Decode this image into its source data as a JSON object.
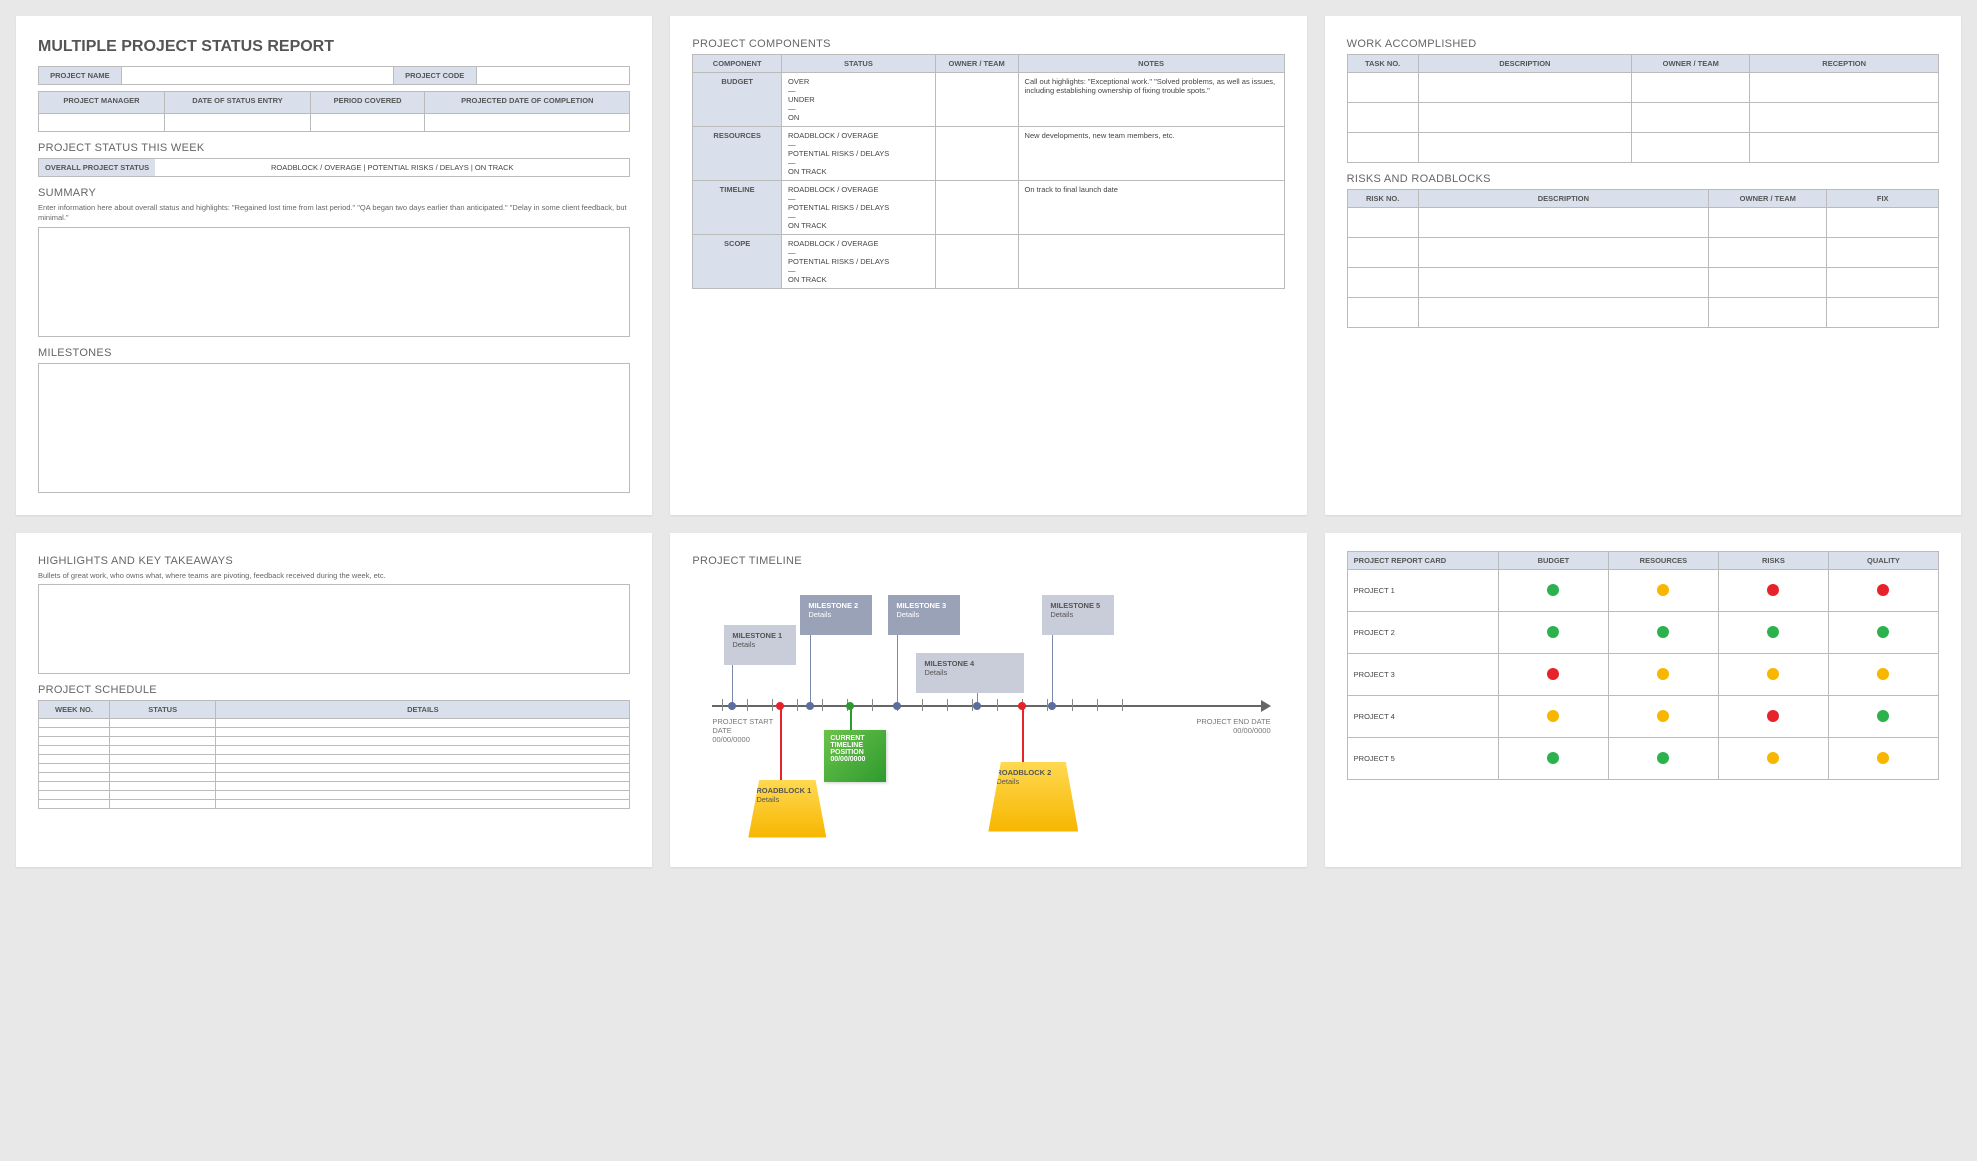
{
  "card1": {
    "title": "MULTIPLE PROJECT STATUS REPORT",
    "info1": {
      "name_lbl": "PROJECT NAME",
      "code_lbl": "PROJECT CODE"
    },
    "info2": {
      "pm": "PROJECT MANAGER",
      "date": "DATE OF STATUS ENTRY",
      "period": "PERIOD COVERED",
      "proj": "PROJECTED DATE OF COMPLETION"
    },
    "status_section": "PROJECT STATUS THIS WEEK",
    "status_lbl": "OVERALL PROJECT STATUS",
    "status_opts": "ROADBLOCK / OVERAGE    |    POTENTIAL RISKS / DELAYS    |    ON TRACK",
    "summary_lbl": "SUMMARY",
    "summary_hint": "Enter information here about overall status and highlights: \"Regained lost time from last period.\" \"QA began two days earlier than anticipated.\" \"Delay in some client feedback, but minimal.\"",
    "milestones_lbl": "MILESTONES"
  },
  "card2": {
    "title": "PROJECT COMPONENTS",
    "cols": [
      "COMPONENT",
      "STATUS",
      "OWNER / TEAM",
      "NOTES"
    ],
    "rows": [
      {
        "c": "BUDGET",
        "s": "OVER\n—\nUNDER\n—\nON",
        "n": "Call out highlights: \"Exceptional work.\" \"Solved problems, as well as issues, including establishing ownership of fixing trouble spots.\""
      },
      {
        "c": "RESOURCES",
        "s": "ROADBLOCK / OVERAGE\n—\nPOTENTIAL RISKS / DELAYS\n—\nON TRACK",
        "n": "New developments, new team members, etc."
      },
      {
        "c": "TIMELINE",
        "s": "ROADBLOCK / OVERAGE\n—\nPOTENTIAL RISKS / DELAYS\n—\nON TRACK",
        "n": "On track to final launch date"
      },
      {
        "c": "SCOPE",
        "s": "ROADBLOCK / OVERAGE\n—\nPOTENTIAL RISKS / DELAYS\n—\nON TRACK",
        "n": ""
      }
    ]
  },
  "card3": {
    "work_title": "WORK ACCOMPLISHED",
    "work_cols": [
      "TASK NO.",
      "DESCRIPTION",
      "OWNER / TEAM",
      "RECEPTION"
    ],
    "risk_title": "RISKS AND ROADBLOCKS",
    "risk_cols": [
      "RISK NO.",
      "DESCRIPTION",
      "OWNER / TEAM",
      "FIX"
    ]
  },
  "card4": {
    "hl_title": "HIGHLIGHTS AND KEY TAKEAWAYS",
    "hl_hint": "Bullets of great work, who owns what, where teams are pivoting, feedback received during the week, etc.",
    "sched_title": "PROJECT SCHEDULE",
    "sched_cols": [
      "WEEK NO.",
      "STATUS",
      "DETAILS"
    ]
  },
  "card5": {
    "title": "PROJECT TIMELINE",
    "start_lbl": "PROJECT START DATE",
    "start_date": "00/00/0000",
    "end_lbl": "PROJECT END DATE",
    "end_date": "00/00/0000",
    "milestones": [
      {
        "t": "MILESTONE 1",
        "d": "Details"
      },
      {
        "t": "MILESTONE 2",
        "d": "Details"
      },
      {
        "t": "MILESTONE 3",
        "d": "Details"
      },
      {
        "t": "MILESTONE 4",
        "d": "Details"
      },
      {
        "t": "MILESTONE 5",
        "d": "Details"
      }
    ],
    "roadblocks": [
      {
        "t": "ROADBLOCK 1",
        "d": "Details"
      },
      {
        "t": "ROADBLOCK 2",
        "d": "Details"
      }
    ],
    "current": {
      "l1": "CURRENT",
      "l2": "TIMELINE",
      "l3": "POSITION",
      "l4": "00/00/0000"
    }
  },
  "card6": {
    "corner": "PROJECT REPORT CARD",
    "cols": [
      "BUDGET",
      "RESOURCES",
      "RISKS",
      "QUALITY"
    ],
    "rows": [
      {
        "p": "PROJECT 1",
        "v": [
          "g",
          "y",
          "r",
          "r"
        ]
      },
      {
        "p": "PROJECT 2",
        "v": [
          "g",
          "g",
          "g",
          "g"
        ]
      },
      {
        "p": "PROJECT 3",
        "v": [
          "r",
          "y",
          "y",
          "y"
        ]
      },
      {
        "p": "PROJECT 4",
        "v": [
          "y",
          "y",
          "r",
          "g"
        ]
      },
      {
        "p": "PROJECT 5",
        "v": [
          "g",
          "g",
          "y",
          "y"
        ]
      }
    ]
  }
}
